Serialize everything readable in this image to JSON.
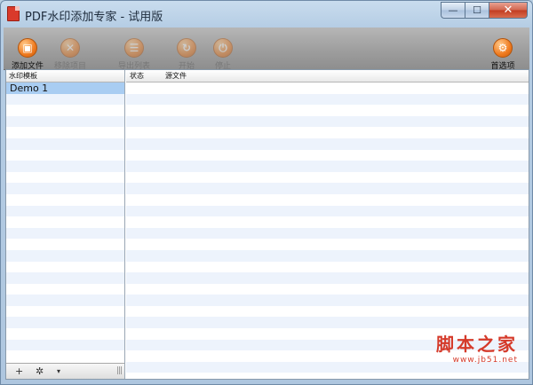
{
  "window": {
    "title": "PDF水印添加专家 - 试用版",
    "controls": {
      "minimize": "—",
      "maximize": "☐",
      "close": "✕"
    }
  },
  "toolbar": {
    "add_file": "添加文件",
    "remove_item": "移除项目",
    "export_list": "导出列表",
    "start": "开始",
    "stop": "停止",
    "preferences": "首选项"
  },
  "left_pane": {
    "header": "水印模板",
    "items": [
      "Demo 1"
    ],
    "footer": {
      "add": "+",
      "settings": "✲",
      "dropdown": "▾",
      "grip": "|||"
    }
  },
  "right_pane": {
    "headers": {
      "status": "状态",
      "source_file": "源文件"
    }
  },
  "watermark": {
    "main": "脚本之家",
    "sub": "www.jb51.net"
  }
}
